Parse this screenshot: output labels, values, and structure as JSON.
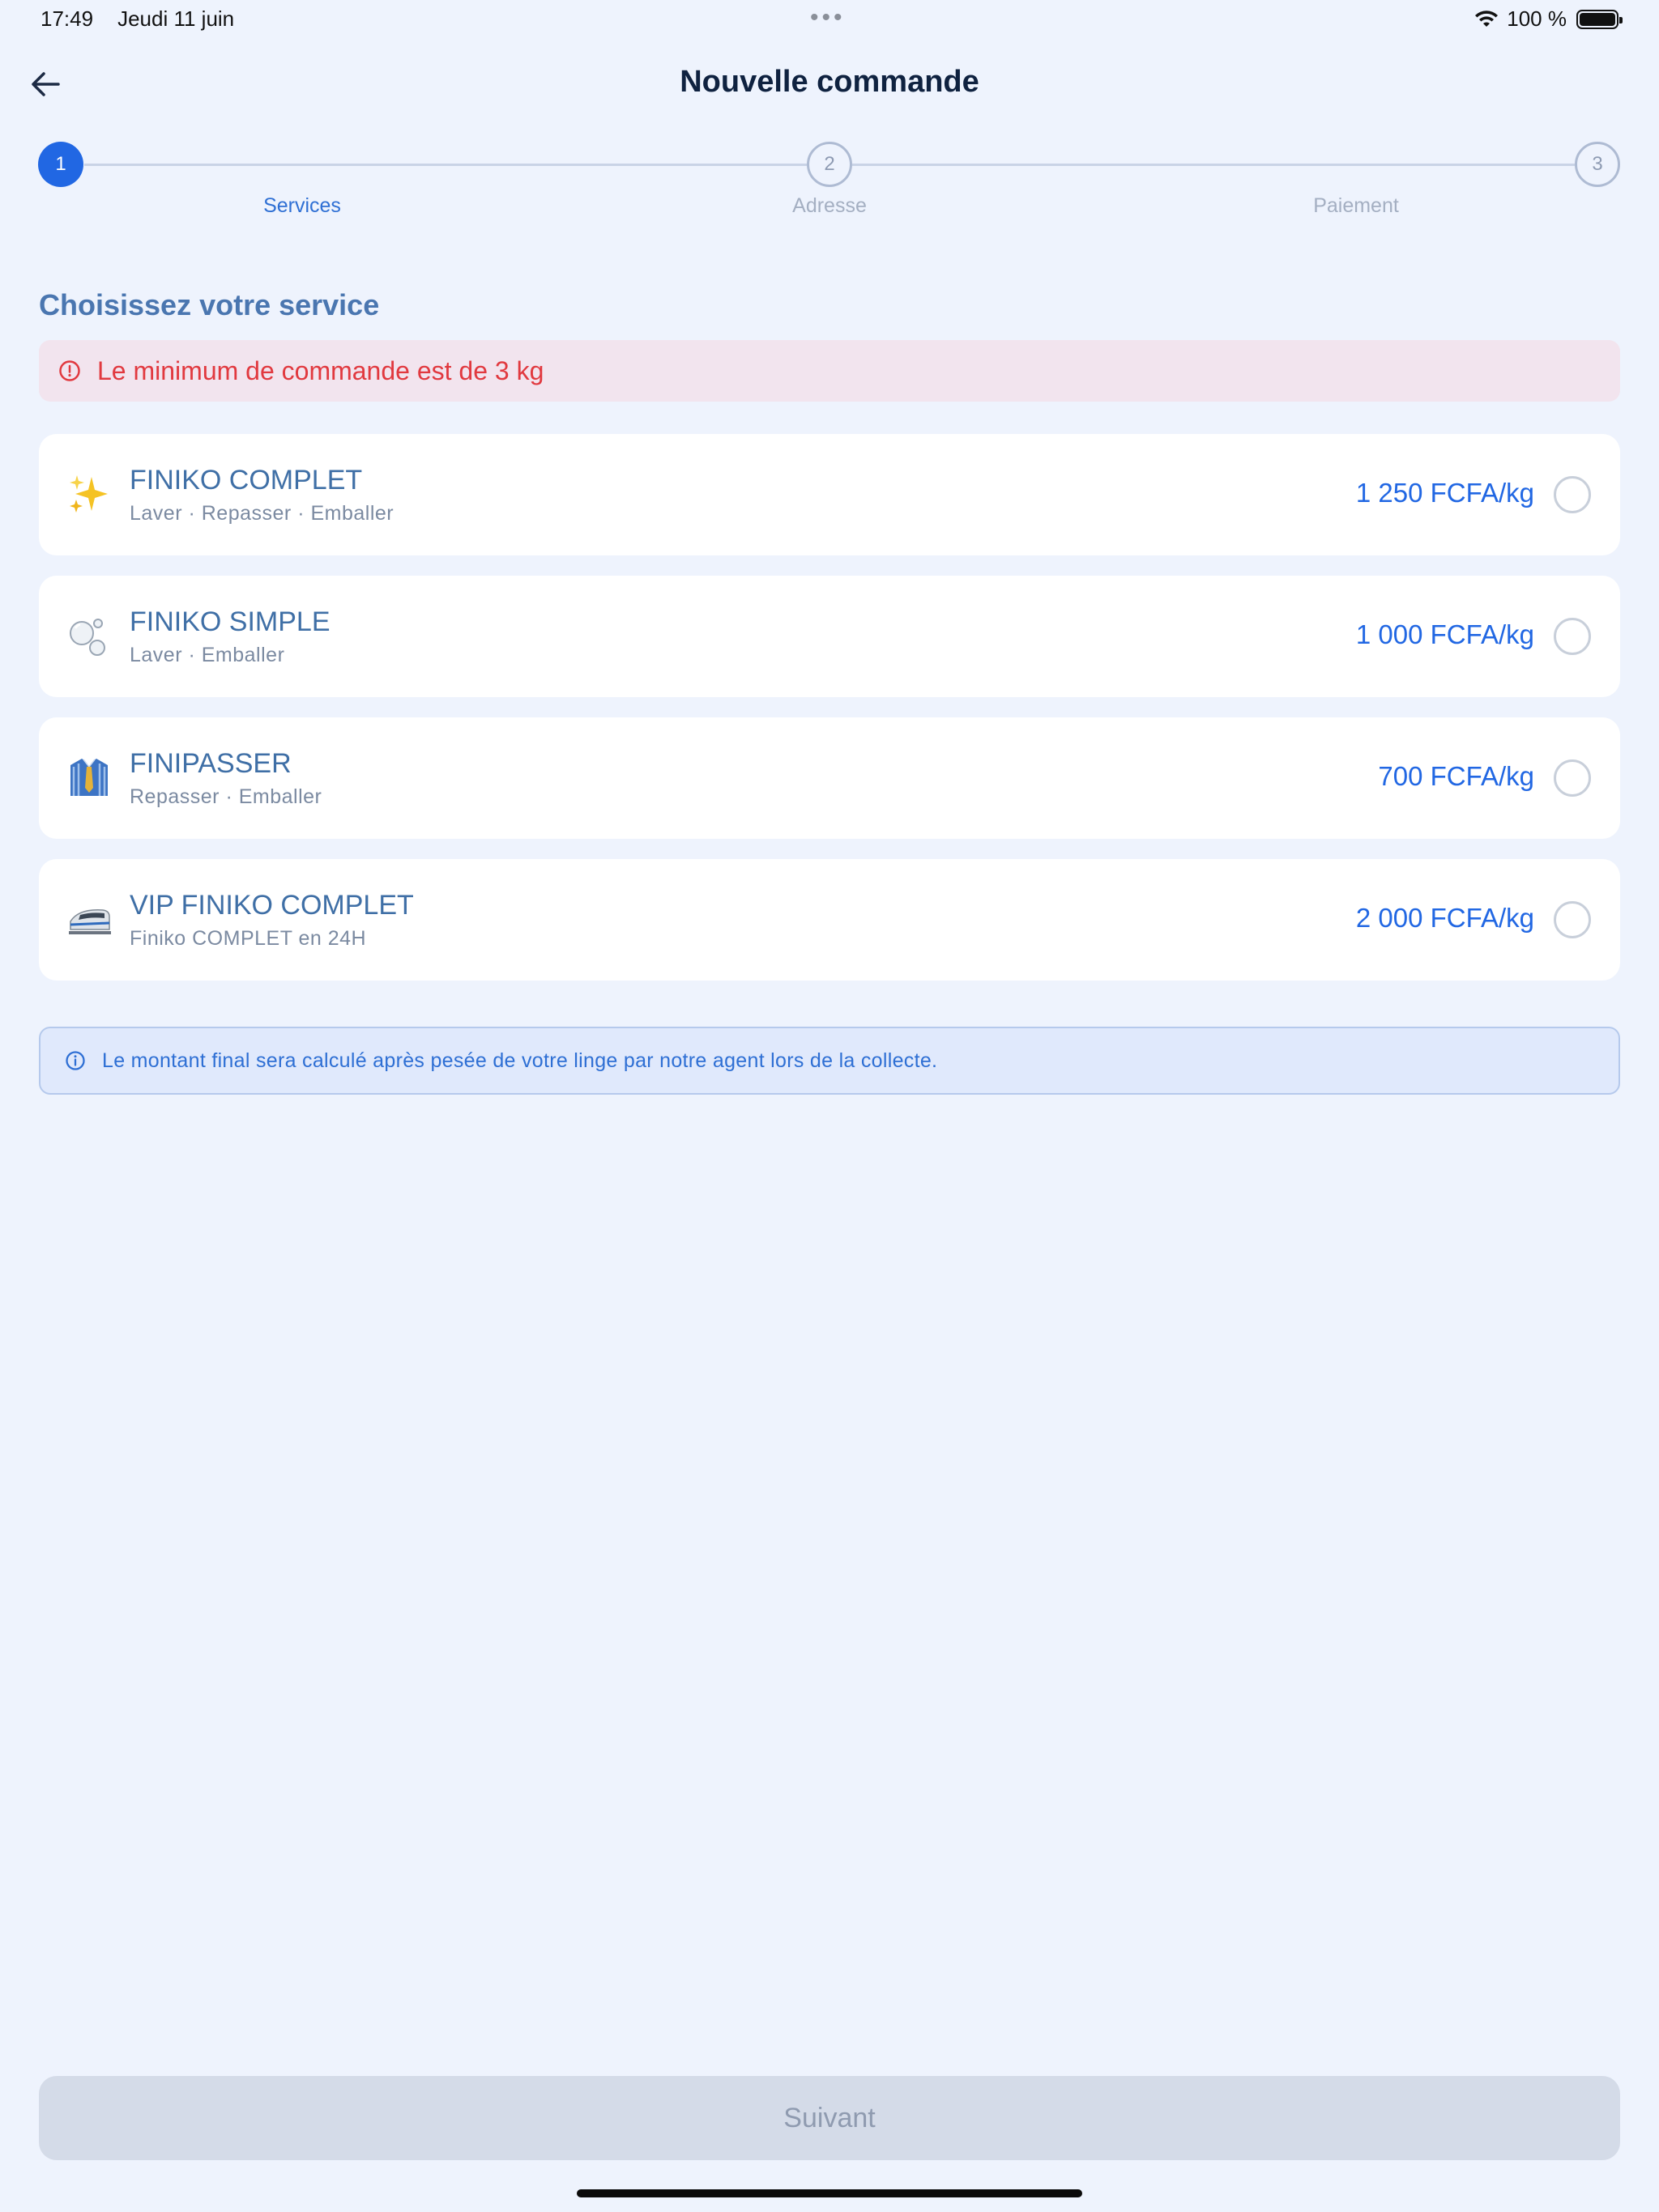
{
  "status_bar": {
    "time": "17:49",
    "date": "Jeudi 11 juin",
    "battery": "100 %",
    "icons": [
      "wifi-icon",
      "battery-icon"
    ]
  },
  "header": {
    "title": "Nouvelle commande",
    "back_icon": "arrow-left-icon"
  },
  "stepper": {
    "steps": [
      {
        "number": "1",
        "label": "Services",
        "state": "active"
      },
      {
        "number": "2",
        "label": "Adresse",
        "state": "inactive"
      },
      {
        "number": "3",
        "label": "Paiement",
        "state": "inactive"
      }
    ]
  },
  "section_title": "Choisissez votre service",
  "alert": {
    "icon": "alert-circle-icon",
    "text": "Le minimum de commande est de 3 kg"
  },
  "services": [
    {
      "icon": "sparkles-icon",
      "name": "FINIKO COMPLET",
      "description": "Laver · Repasser · Emballer",
      "price": "1 250 FCFA/kg",
      "selected": false
    },
    {
      "icon": "bubbles-icon",
      "name": "FINIKO SIMPLE",
      "description": "Laver · Emballer",
      "price": "1 000 FCFA/kg",
      "selected": false
    },
    {
      "icon": "shirt-icon",
      "name": "FINIPASSER",
      "description": "Repasser · Emballer",
      "price": "700 FCFA/kg",
      "selected": false
    },
    {
      "icon": "bullet-train-icon",
      "name": "VIP FINIKO COMPLET",
      "description": "Finiko COMPLET en 24H",
      "price": "2 000 FCFA/kg",
      "selected": false
    }
  ],
  "info_note": {
    "icon": "info-circle-icon",
    "text": "Le montant final sera calculé après pesée de votre linge par notre agent lors de la collecte."
  },
  "next_button": {
    "label": "Suivant",
    "enabled": false
  },
  "colors": {
    "background": "#eef3fd",
    "accent": "#2167e3",
    "error": "#e1393f",
    "disabled_button": "#d4dbe8"
  }
}
